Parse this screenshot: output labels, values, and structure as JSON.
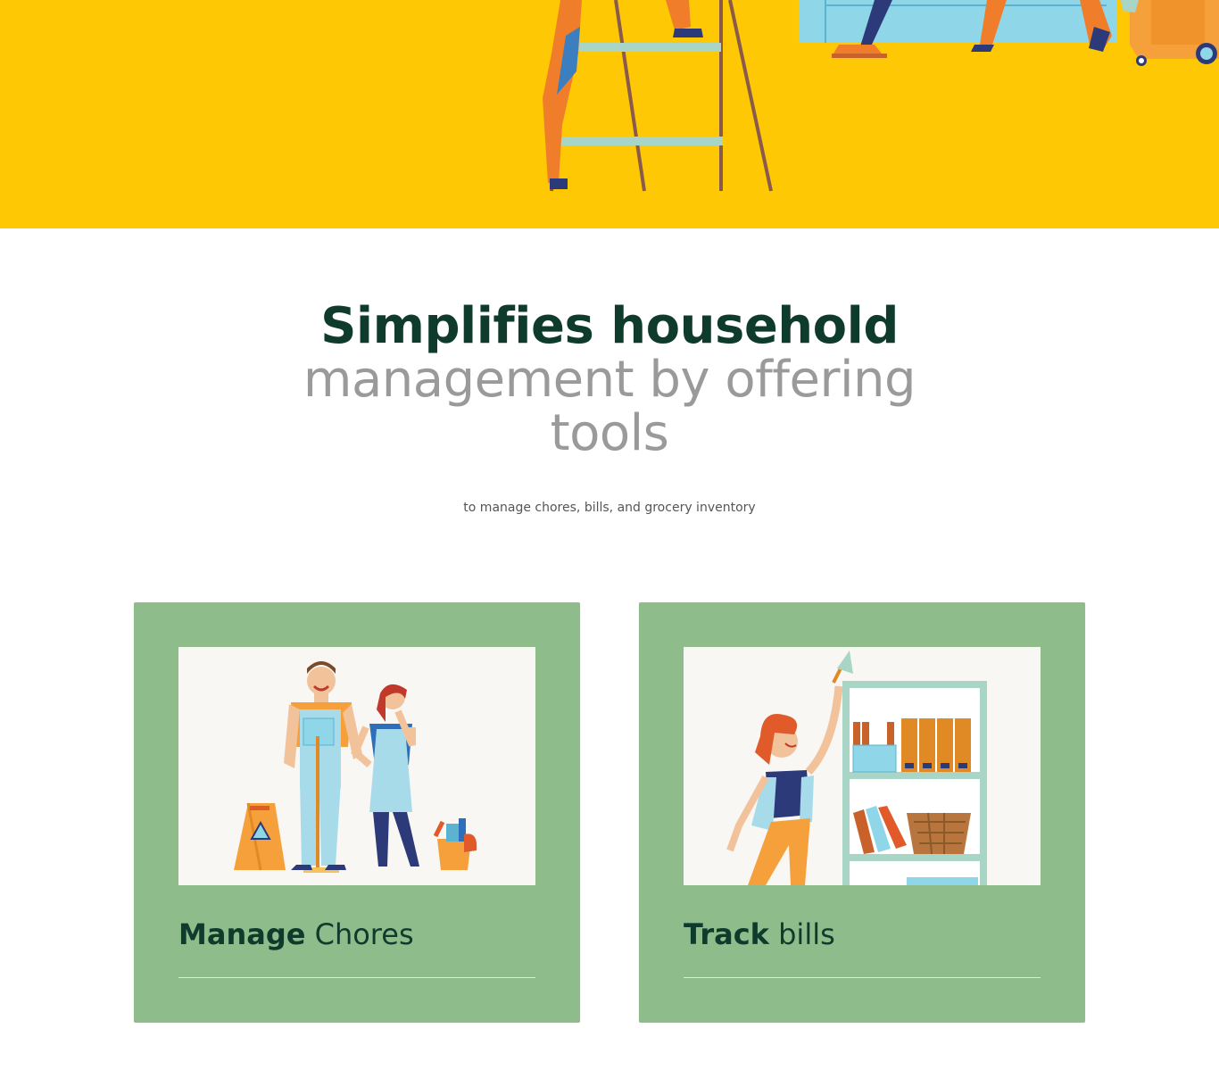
{
  "headline": {
    "strong": "Simplifies household",
    "light": "management by offering tools"
  },
  "subline": "to manage chores, bills, and grocery inventory",
  "cards": [
    {
      "title_bold": "Manage",
      "title_rest": " Chores"
    },
    {
      "title_bold": "Track",
      "title_rest": " bills"
    }
  ],
  "colors": {
    "hero_bg": "#ffc804",
    "heading_dark": "#0f3b2c",
    "heading_light": "#9a9a9a",
    "card_bg": "#8fbc8b"
  }
}
